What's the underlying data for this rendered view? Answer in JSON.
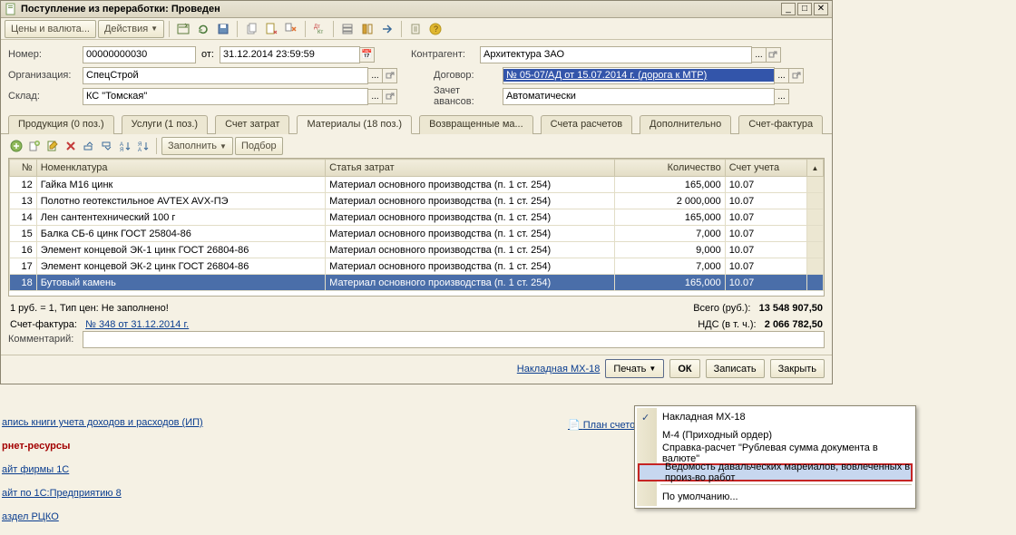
{
  "window": {
    "title": "Поступление из переработки: Проведен"
  },
  "toolbar": {
    "prices": "Цены и валюта...",
    "actions": "Действия"
  },
  "form": {
    "number_label": "Номер:",
    "number": "00000000030",
    "from_label": "от:",
    "date": "31.12.2014 23:59:59",
    "org_label": "Организация:",
    "org": "СпецСтрой",
    "sklad_label": "Склад:",
    "sklad": "КС \"Томская\"",
    "contr_label": "Контрагент:",
    "contr": "Архитектура ЗАО",
    "dog_label": "Договор:",
    "dog": "№ 05-07/АД от 15.07.2014 г. (дорога к МТР)",
    "avans_label": "Зачет авансов:",
    "avans": "Автоматически"
  },
  "tabs": [
    "Продукция (0 поз.)",
    "Услуги (1 поз.)",
    "Счет затрат",
    "Материалы (18 поз.)",
    "Возвращенные ма...",
    "Счета расчетов",
    "Дополнительно",
    "Счет-фактура"
  ],
  "tabtoolbar": {
    "fill": "Заполнить",
    "pick": "Подбор"
  },
  "columns": {
    "no": "№",
    "nom": "Номенклатура",
    "stat": "Статья затрат",
    "qty": "Количество",
    "acc": "Счет учета",
    "scroll": "▲"
  },
  "rows": [
    {
      "n": "12",
      "nom": "Гайка М16 цинк",
      "stat": "Материал основного производства (п. 1 ст. 254)",
      "qty": "165,000",
      "acc": "10.07"
    },
    {
      "n": "13",
      "nom": "Полотно геотекстильное AVTEX AVX-ПЭ",
      "stat": "Материал основного производства (п. 1 ст. 254)",
      "qty": "2 000,000",
      "acc": "10.07"
    },
    {
      "n": "14",
      "nom": "Лен сантентехнический 100 г",
      "stat": "Материал основного производства (п. 1 ст. 254)",
      "qty": "165,000",
      "acc": "10.07"
    },
    {
      "n": "15",
      "nom": "Балка СБ-6 цинк ГОСТ 25804-86",
      "stat": "Материал основного производства (п. 1 ст. 254)",
      "qty": "7,000",
      "acc": "10.07"
    },
    {
      "n": "16",
      "nom": "Элемент концевой ЭК-1 цинк ГОСТ 26804-86",
      "stat": "Материал основного производства (п. 1 ст. 254)",
      "qty": "9,000",
      "acc": "10.07"
    },
    {
      "n": "17",
      "nom": "Элемент концевой ЭК-2 цинк ГОСТ 26804-86",
      "stat": "Материал основного производства (п. 1 ст. 254)",
      "qty": "7,000",
      "acc": "10.07"
    },
    {
      "n": "18",
      "nom": "Бутовый камень",
      "stat": "Материал основного производства (п. 1 ст. 254)",
      "qty": "165,000",
      "acc": "10.07"
    }
  ],
  "summary": {
    "leftline1": "1 руб. = 1, Тип цен: Не заполнено!",
    "total_label": "Всего (руб.):",
    "total": "13 548 907,50",
    "sf_label": "Счет-фактура:",
    "sf": "№ 348 от 31.12.2014 г.",
    "nds_label": "НДС (в т. ч.):",
    "nds": "2 066 782,50",
    "comment_label": "Комментарий:"
  },
  "bottom": {
    "mx18": "Накладная МХ-18",
    "print": "Печать",
    "ok": "ОК",
    "save": "Записать",
    "close": "Закрыть"
  },
  "menu": {
    "i1": "Накладная МХ-18",
    "i2": "М-4 (Приходный ордер)",
    "i3": "Справка-расчет \"Рублевая сумма документа в валюте\"",
    "i4": "Ведомость давальческих мареиалов, вовлеченных в произ-во работ",
    "i5": "По умолчанию..."
  },
  "bg": {
    "l1": "апись книги учета доходов и расходов (ИП)",
    "h1": "рнет-ресурсы",
    "l2": "айт фирмы 1С",
    "l3": "айт по 1С:Предприятию 8",
    "l4": "аздел РЦКО",
    "plan": "План счетов бу"
  }
}
